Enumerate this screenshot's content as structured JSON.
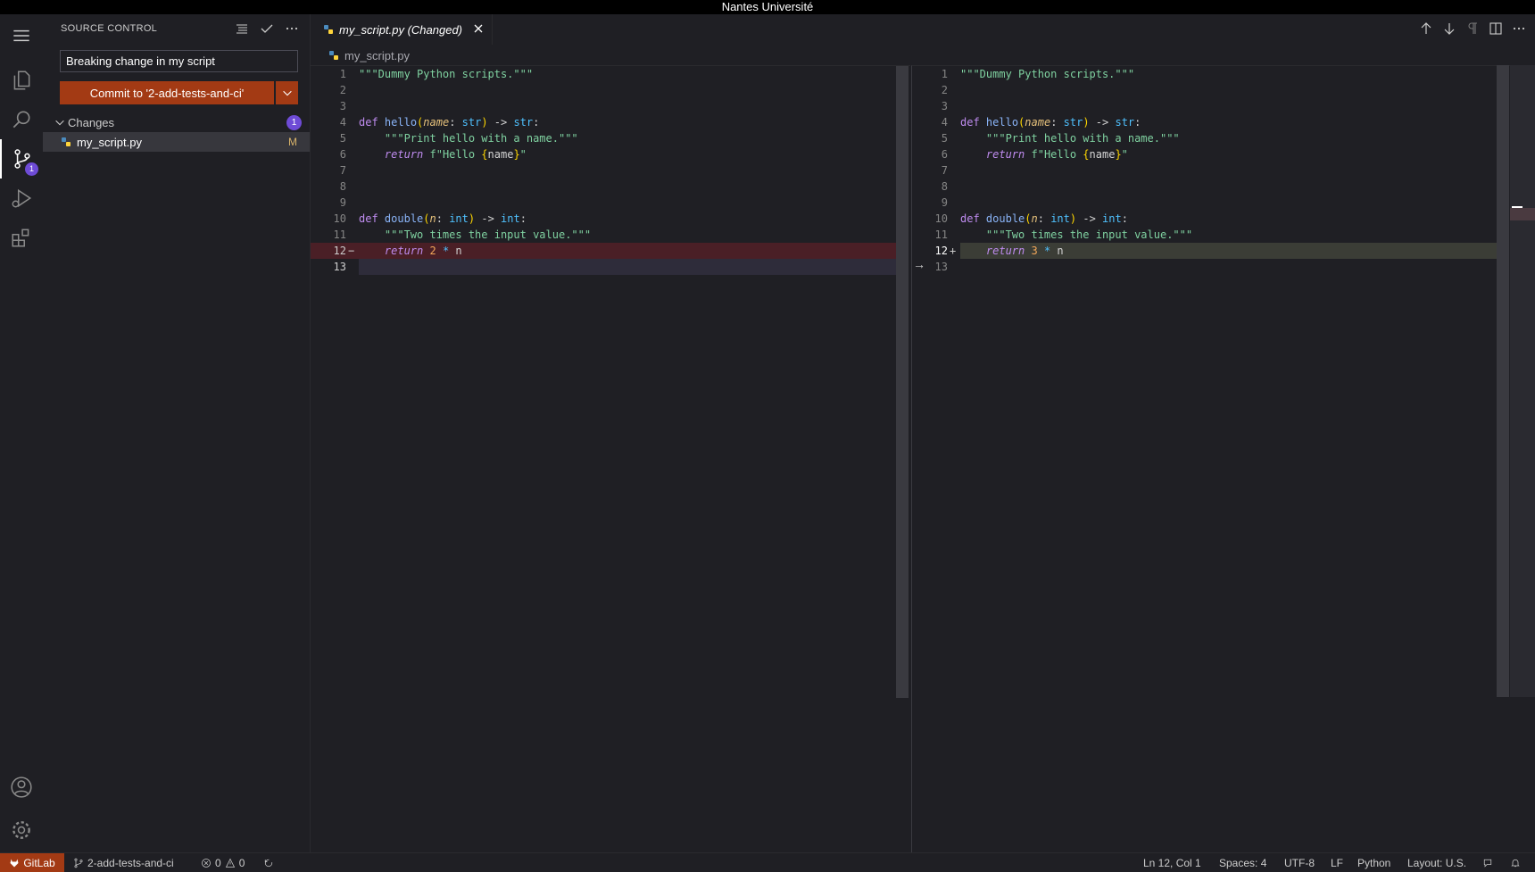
{
  "window": {
    "title": "Nantes Université"
  },
  "sidebar": {
    "header": "SOURCE CONTROL",
    "commit_message": "Breaking change in my script",
    "commit_button": "Commit to '2-add-tests-and-ci'",
    "changes_label": "Changes",
    "changes_count": "1",
    "scm_badge": "1",
    "files": [
      {
        "name": "my_script.py",
        "status": "M"
      }
    ]
  },
  "tab": {
    "label": "my_script.py (Changed)"
  },
  "breadcrumb": "my_script.py",
  "diff": {
    "left": {
      "lines": [
        {
          "n": "1",
          "text": "\"\"\"Dummy Python scripts.\"\"\""
        },
        {
          "n": "2",
          "text": ""
        },
        {
          "n": "3",
          "text": ""
        },
        {
          "n": "4",
          "text": "def hello(name: str) -> str:"
        },
        {
          "n": "5",
          "text": "    \"\"\"Print hello with a name.\"\"\""
        },
        {
          "n": "6",
          "text": "    return f\"Hello {name}\""
        },
        {
          "n": "7",
          "text": ""
        },
        {
          "n": "8",
          "text": ""
        },
        {
          "n": "9",
          "text": ""
        },
        {
          "n": "10",
          "text": "def double(n: int) -> int:"
        },
        {
          "n": "11",
          "text": "    \"\"\"Two times the input value.\"\"\""
        },
        {
          "n": "12",
          "text": "    return 2 * n"
        },
        {
          "n": "13",
          "text": ""
        }
      ]
    },
    "right": {
      "lines": [
        {
          "n": "1",
          "text": "\"\"\"Dummy Python scripts.\"\"\""
        },
        {
          "n": "2",
          "text": ""
        },
        {
          "n": "3",
          "text": ""
        },
        {
          "n": "4",
          "text": "def hello(name: str) -> str:"
        },
        {
          "n": "5",
          "text": "    \"\"\"Print hello with a name.\"\"\""
        },
        {
          "n": "6",
          "text": "    return f\"Hello {name}\""
        },
        {
          "n": "7",
          "text": ""
        },
        {
          "n": "8",
          "text": ""
        },
        {
          "n": "9",
          "text": ""
        },
        {
          "n": "10",
          "text": "def double(n: int) -> int:"
        },
        {
          "n": "11",
          "text": "    \"\"\"Two times the input value.\"\"\""
        },
        {
          "n": "12",
          "text": "    return 3 * n"
        },
        {
          "n": "13",
          "text": ""
        }
      ]
    }
  },
  "statusbar": {
    "remote": "GitLab",
    "branch": "2-add-tests-and-ci",
    "errors": "0",
    "warnings": "0",
    "position": "Ln 12, Col 1",
    "spaces": "Spaces: 4",
    "encoding": "UTF-8",
    "eol": "LF",
    "language": "Python",
    "layout": "Layout: U.S."
  },
  "colors": {
    "accent": "#a33a14",
    "badge": "#6e4bd6",
    "deleted": "#4a1f26",
    "inserted": "#3b3d36"
  }
}
